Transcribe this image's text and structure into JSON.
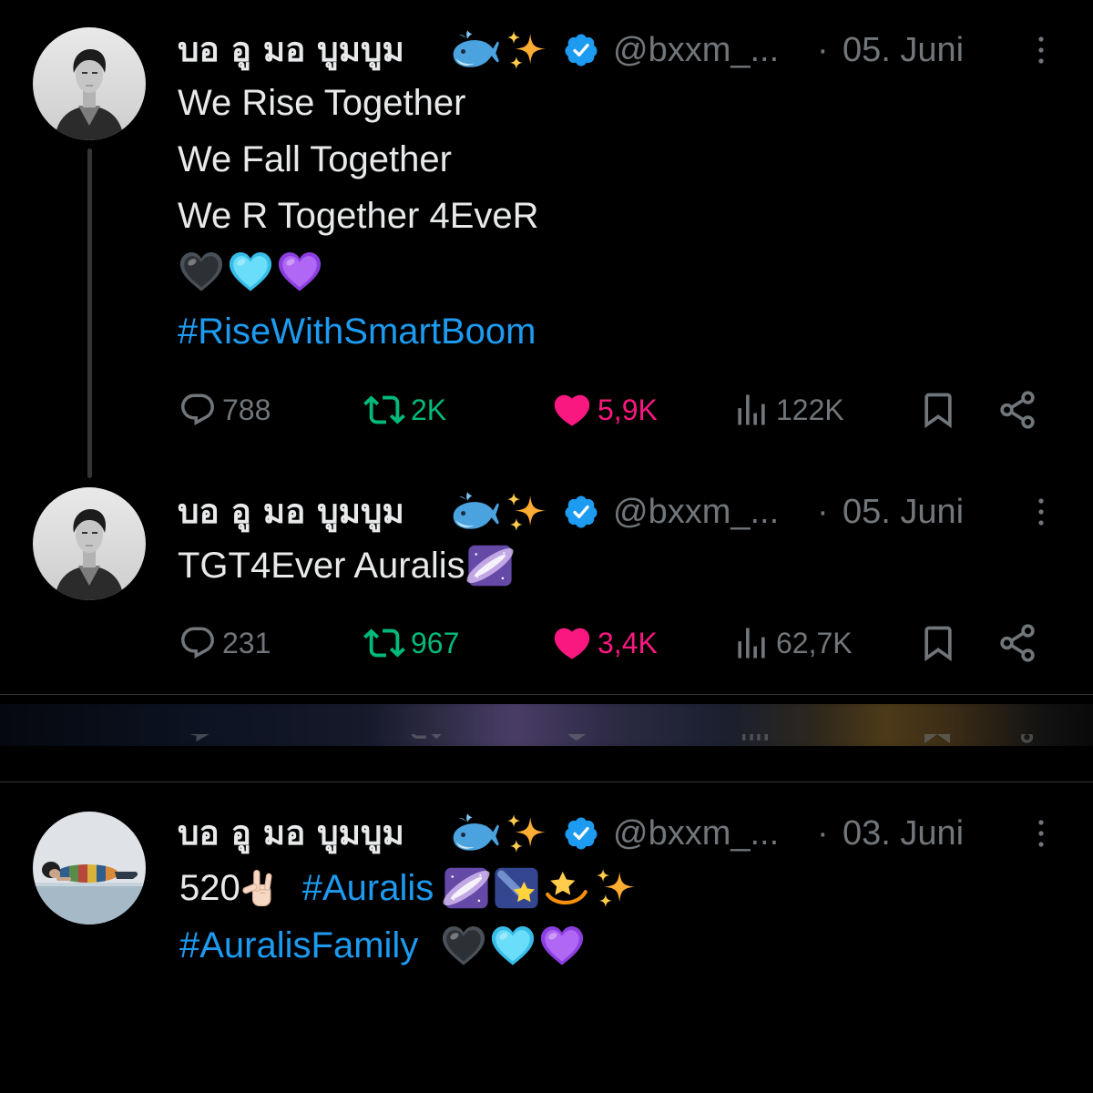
{
  "colors": {
    "background": "#000000",
    "text": "#e7e9ea",
    "muted": "#71767b",
    "link": "#1d9bf0",
    "repost": "#00ba7c",
    "like": "#f91880",
    "verified": "#1d9bf0"
  },
  "tweets": [
    {
      "author": {
        "name": "บอ อู มอ บูมบูม",
        "name_emoji": [
          "whale",
          "sparkles"
        ],
        "verified": true,
        "handle": "@bxxm_...",
        "separator": "·",
        "date": "05. Juni"
      },
      "lines": [
        "We Rise Together",
        "We Fall Together",
        "We R Together 4EveR"
      ],
      "emoji_line": [
        "black-heart",
        "light-blue-heart",
        "purple-heart"
      ],
      "hashtag": "#RiseWithSmartBoom",
      "stats": {
        "replies": "788",
        "reposts": "2K",
        "likes": "5,9K",
        "views": "122K"
      },
      "reposted": true,
      "liked": true
    },
    {
      "author": {
        "name": "บอ อู มอ บูมบูม",
        "name_emoji": [
          "whale",
          "sparkles"
        ],
        "verified": true,
        "handle": "@bxxm_...",
        "separator": "·",
        "date": "05. Juni"
      },
      "text": "TGT4Ever Auralis",
      "text_emoji": [
        "milky-way"
      ],
      "stats": {
        "replies": "231",
        "reposts": "967",
        "likes": "3,4K",
        "views": "62,7K"
      },
      "reposted": true,
      "liked": true
    },
    {
      "author": {
        "name": "บอ อู มอ บูมบูม",
        "name_emoji": [
          "whale",
          "sparkles"
        ],
        "verified": true,
        "handle": "@bxxm_...",
        "separator": "·",
        "date": "03. Juni"
      },
      "line1": {
        "text": "520",
        "emoji": [
          "love-you-gesture-light-skin"
        ],
        "hashtag": "#Auralis",
        "trailing_emoji": [
          "milky-way",
          "shooting-star",
          "dizzy",
          "sparkles"
        ]
      },
      "line2": {
        "hashtag": "#AuralisFamily",
        "emoji": [
          "black-heart",
          "light-blue-heart",
          "purple-heart"
        ]
      }
    }
  ]
}
